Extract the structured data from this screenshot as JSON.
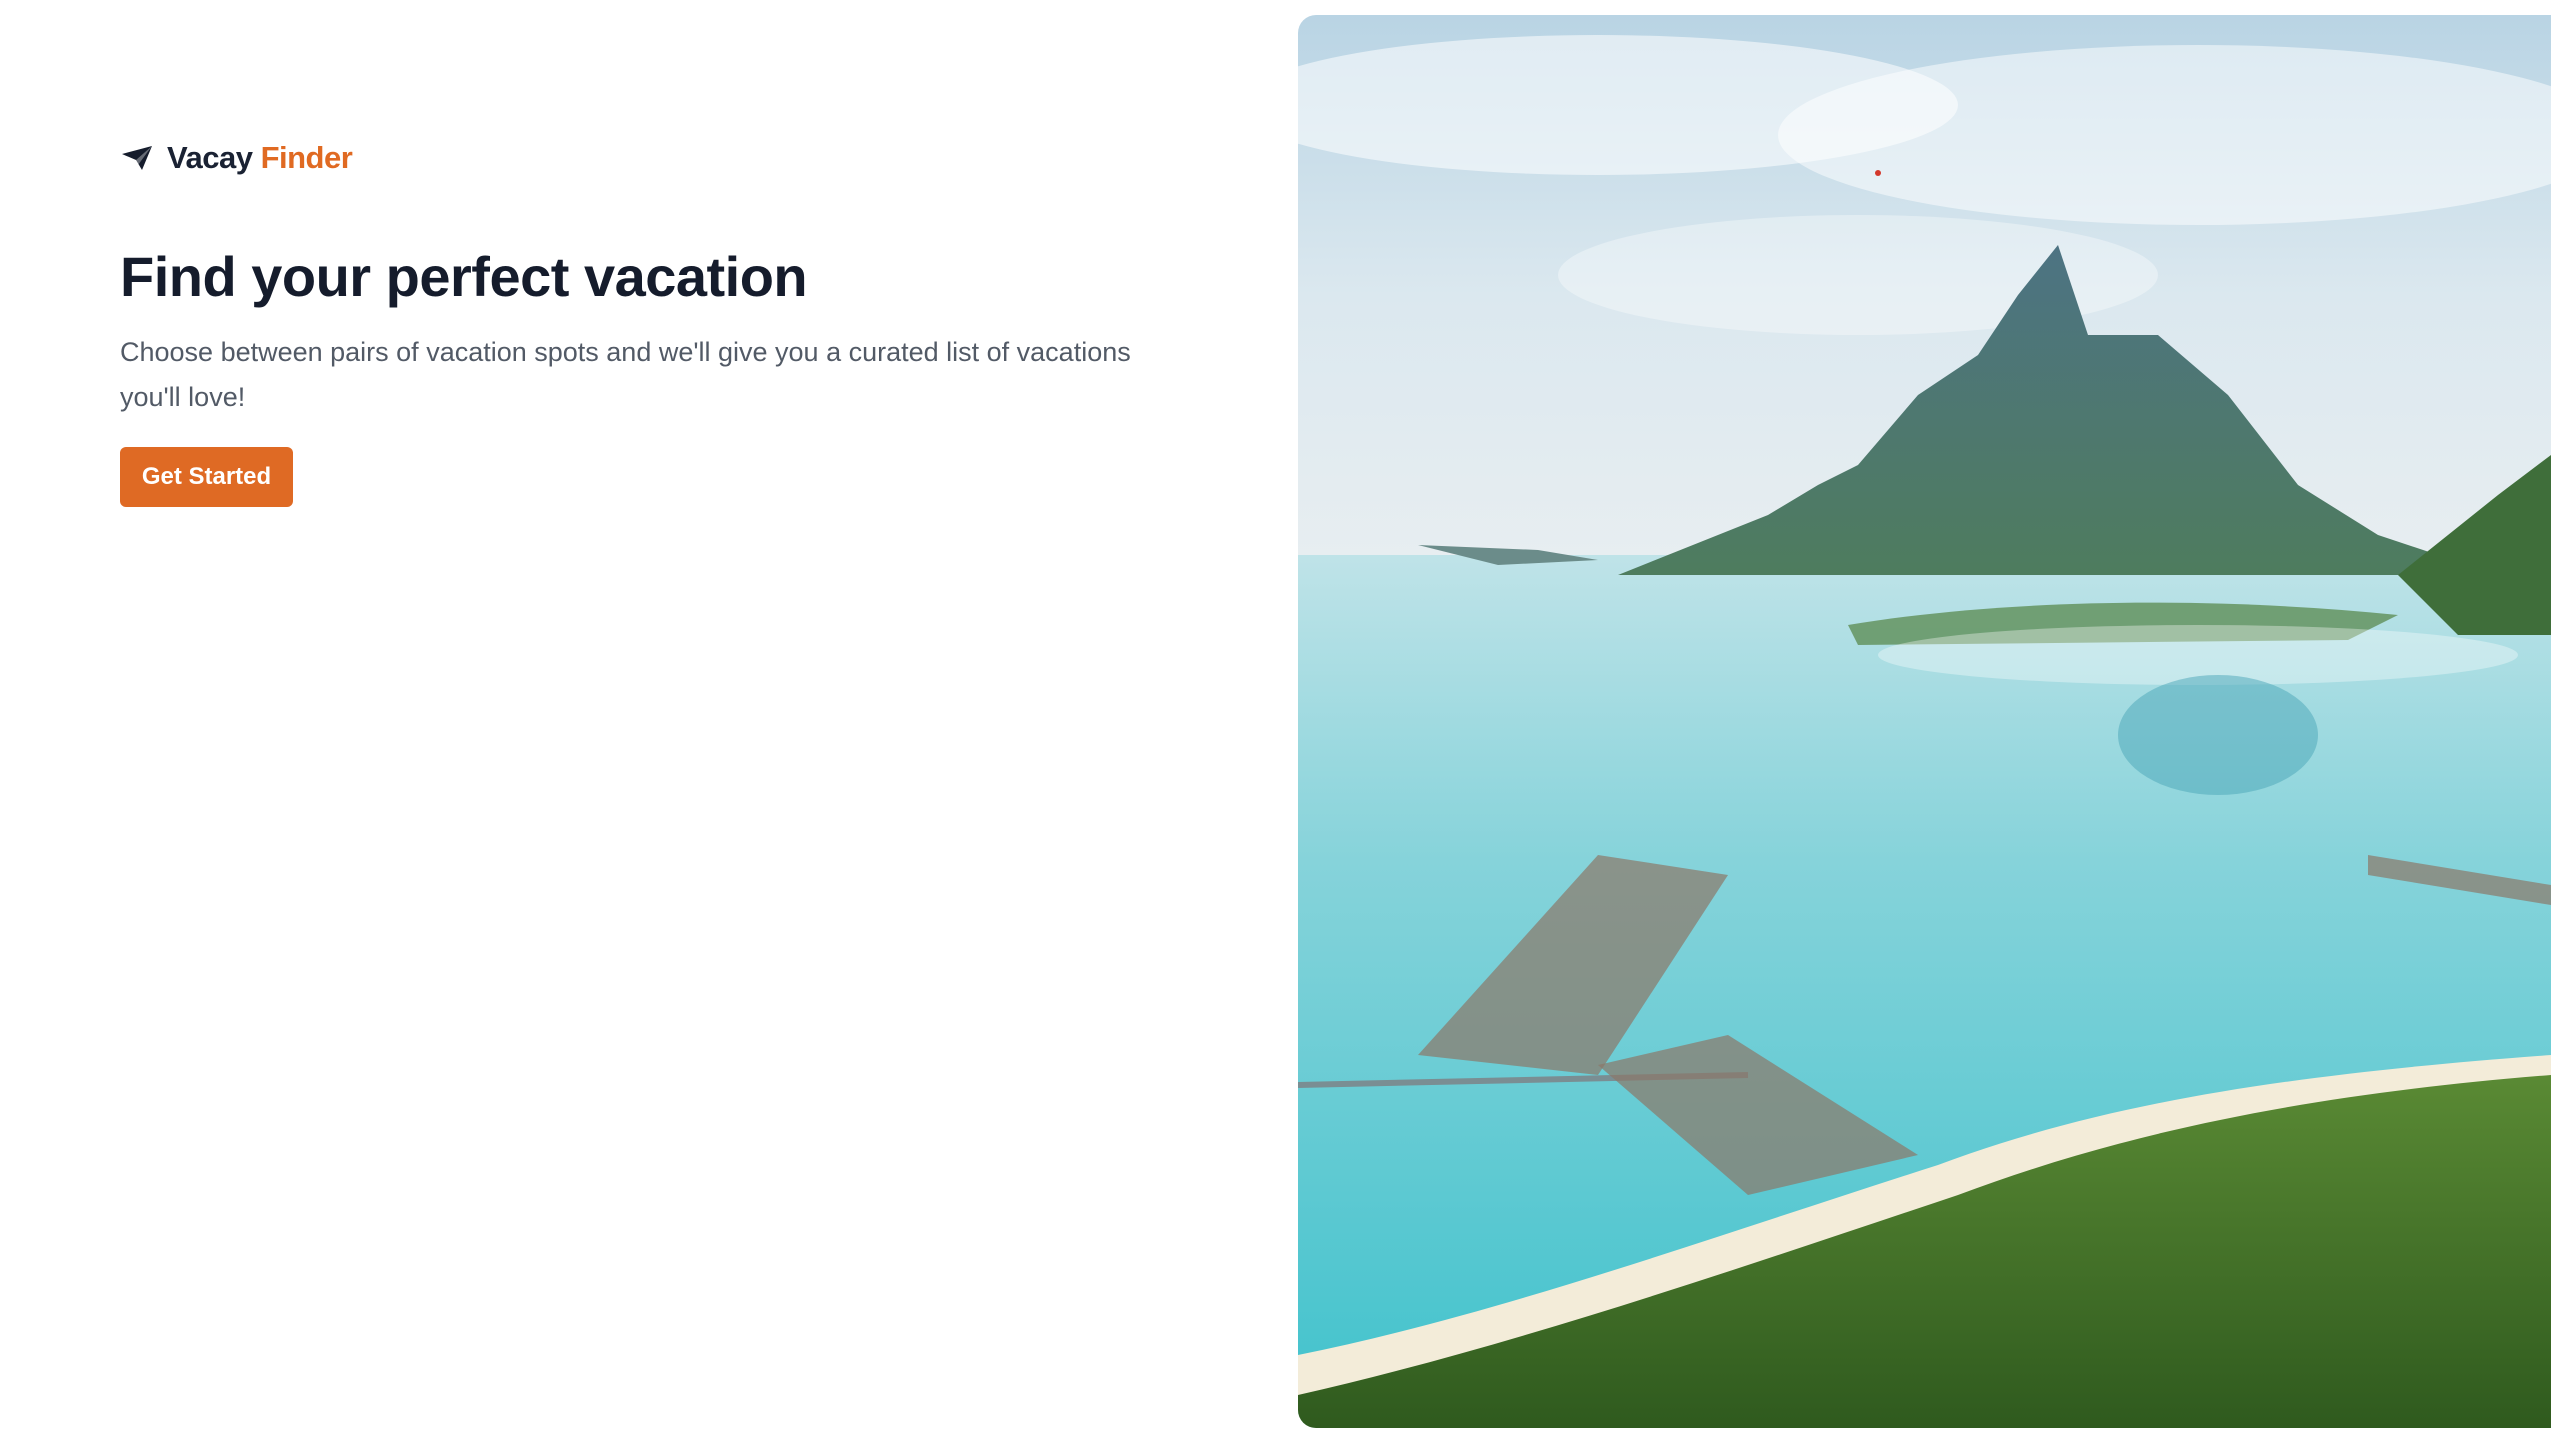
{
  "brand": {
    "name_main": "Vacay",
    "name_accent": "Finder",
    "icon": "paper-plane-icon",
    "accent_color": "#e06a22"
  },
  "hero": {
    "headline": "Find your perfect vacation",
    "subtext": "Choose between pairs of vacation spots and we'll give you a curated list of vacations you'll love!",
    "cta_label": "Get Started"
  },
  "image": {
    "subject": "aerial-tropical-island-overwater-bungalows"
  }
}
